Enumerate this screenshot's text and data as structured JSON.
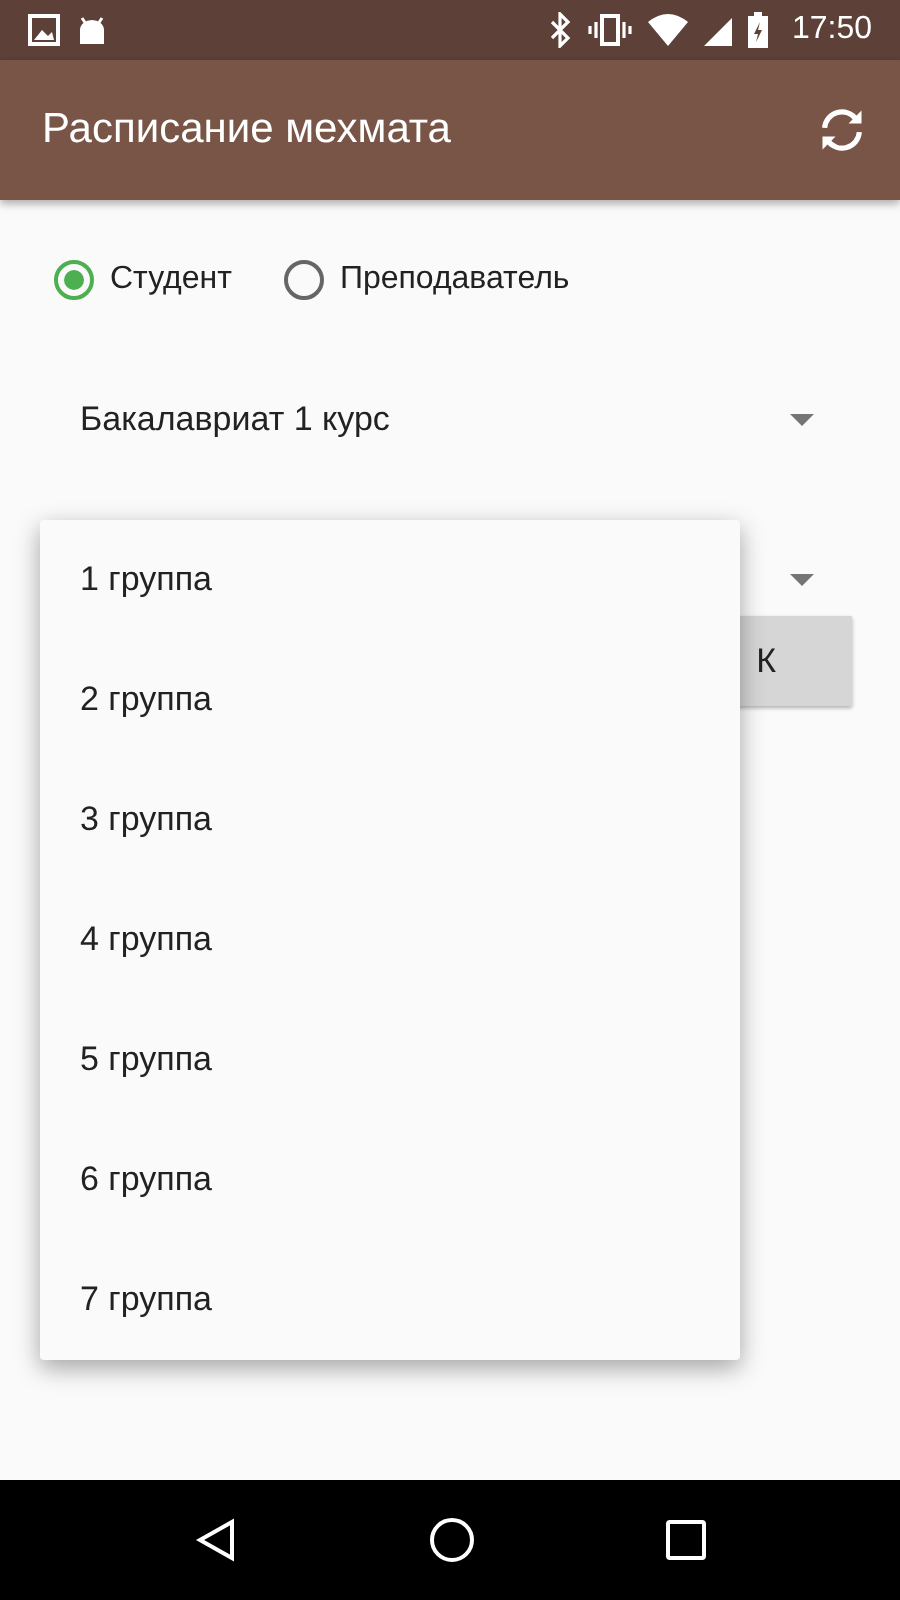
{
  "status_bar": {
    "time": "17:50"
  },
  "app_bar": {
    "title": "Расписание мехмата"
  },
  "role_options": [
    {
      "label": "Студент",
      "selected": true
    },
    {
      "label": "Преподаватель",
      "selected": false
    }
  ],
  "course_spinner": {
    "value": "Бакалавриат 1 курс"
  },
  "ok_button": {
    "label": "К"
  },
  "group_menu": {
    "items": [
      "1 группа",
      "2 группа",
      "3 группа",
      "4 группа",
      "5 группа",
      "6 группа",
      "7 группа"
    ]
  }
}
